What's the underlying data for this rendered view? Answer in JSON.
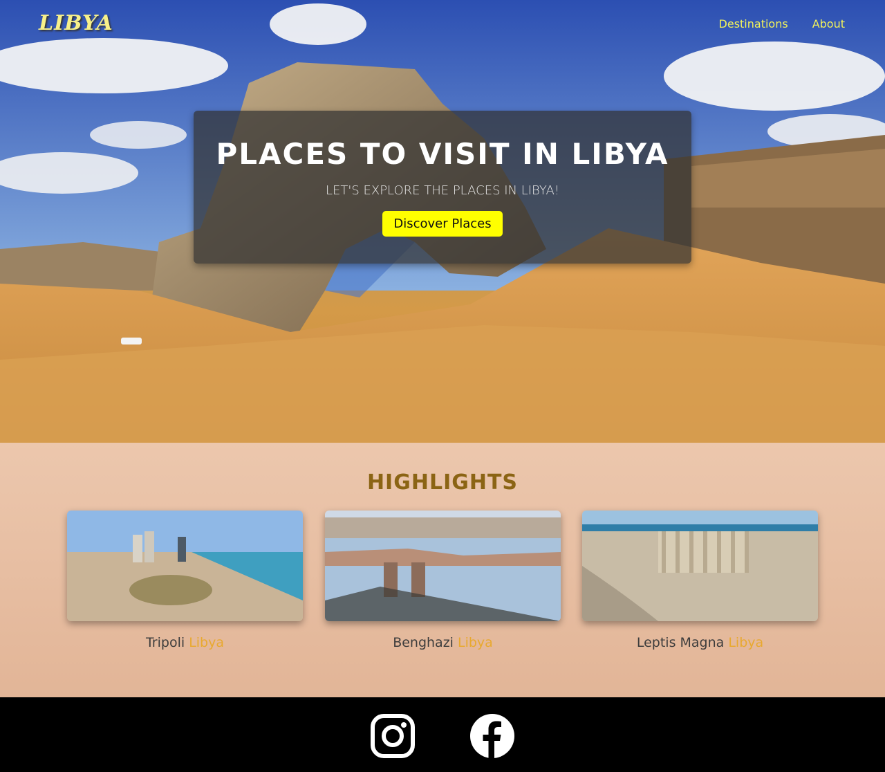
{
  "nav": {
    "logo": "LIBYA",
    "links": [
      "Destinations",
      "About"
    ]
  },
  "hero": {
    "title": "PLACES TO VISIT IN LIBYA",
    "subtitle": "LET'S EXPLORE THE PLACES IN LIBYA!",
    "button": "Discover Places"
  },
  "highlights": {
    "title": "HIGHLIGHTS",
    "cards": [
      {
        "name": "Tripoli",
        "accent": "Libya"
      },
      {
        "name": "Benghazi",
        "accent": "Libya"
      },
      {
        "name": "Leptis Magna",
        "accent": "Libya"
      }
    ]
  },
  "footer": {
    "icons": [
      "instagram-icon",
      "facebook-icon"
    ]
  },
  "colors": {
    "nav_link": "#f2f25a",
    "button_bg": "#ffff00",
    "highlights_title": "#8b6414",
    "accent": "#e8a92f"
  }
}
